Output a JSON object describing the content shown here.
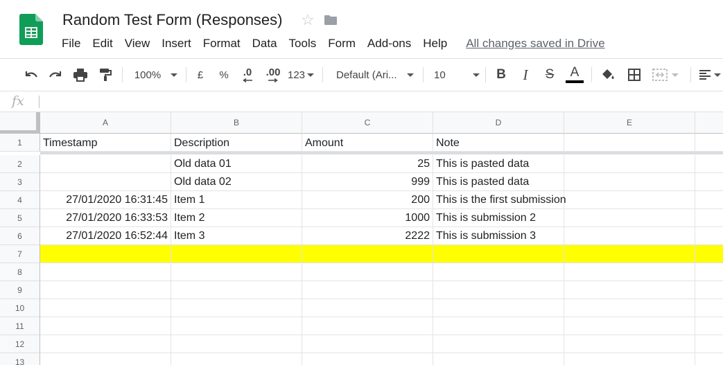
{
  "app": {
    "doc_title": "Random Test Form (Responses)",
    "menus": [
      "File",
      "Edit",
      "View",
      "Insert",
      "Format",
      "Data",
      "Tools",
      "Form",
      "Add-ons",
      "Help"
    ],
    "saved_status": "All changes saved in Drive"
  },
  "toolbar": {
    "zoom": "100%",
    "currency": "£",
    "percent": "%",
    "decrease_decimals": ".0",
    "increase_decimals": ".00",
    "more_formats": "123",
    "font": "Default (Ari...",
    "font_size": "10",
    "text_color": "#000000"
  },
  "formula_bar": {
    "fx_label": "fx",
    "value": ""
  },
  "grid": {
    "columns": [
      "A",
      "B",
      "C",
      "D",
      "E"
    ],
    "row_numbers": [
      "1",
      "2",
      "3",
      "4",
      "5",
      "6",
      "7",
      "8",
      "9",
      "10",
      "11",
      "12",
      "13"
    ],
    "rows": [
      [
        "Timestamp",
        "Description",
        "Amount",
        "Note",
        ""
      ],
      [
        "",
        "Old data 01",
        "25",
        "This is pasted data",
        ""
      ],
      [
        "",
        "Old data 02",
        "999",
        "This is pasted data",
        ""
      ],
      [
        "27/01/2020 16:31:45",
        "Item 1",
        "200",
        "This is the first submission",
        ""
      ],
      [
        "27/01/2020 16:33:53",
        "Item 2",
        "1000",
        "This is submission 2",
        ""
      ],
      [
        "27/01/2020 16:52:44",
        "Item 3",
        "2222",
        "This is submission 3",
        ""
      ],
      [
        "",
        "",
        "",
        "",
        ""
      ],
      [
        "",
        "",
        "",
        "",
        ""
      ],
      [
        "",
        "",
        "",
        "",
        ""
      ],
      [
        "",
        "",
        "",
        "",
        ""
      ],
      [
        "",
        "",
        "",
        "",
        ""
      ],
      [
        "",
        "",
        "",
        "",
        ""
      ],
      [
        "",
        "",
        "",
        "",
        ""
      ]
    ],
    "highlight_row_color": "#ffff00"
  },
  "colors": {
    "sheets_green": "#0f9d58",
    "header_bg": "#f8f9fa",
    "grid_line": "#e2e3e3"
  }
}
